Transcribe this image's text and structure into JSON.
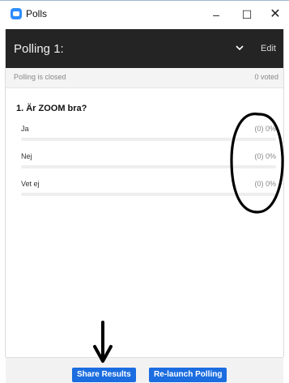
{
  "window": {
    "title": "Polls",
    "minimize_glyph": "–",
    "maximize_glyph": "☐",
    "close_glyph": "✕"
  },
  "poll": {
    "title": "Polling 1:",
    "edit_label": "Edit",
    "status": "Polling is closed",
    "voted": "0 voted"
  },
  "question": {
    "text": "1. Är ZOOM bra?",
    "answers": [
      {
        "label": "Ja",
        "result": "(0) 0%",
        "percent": 0
      },
      {
        "label": "Nej",
        "result": "(0) 0%",
        "percent": 0
      },
      {
        "label": "Vet ej",
        "result": "(0) 0%",
        "percent": 0
      }
    ]
  },
  "footer": {
    "share_label": "Share Results",
    "relaunch_label": "Re-launch Polling"
  },
  "colors": {
    "accent": "#2d8cff",
    "button": "#1b6de0",
    "header": "#242424"
  },
  "icons": [
    "app-icon",
    "chevron-down-icon",
    "minimize-icon",
    "maximize-icon",
    "close-icon"
  ]
}
